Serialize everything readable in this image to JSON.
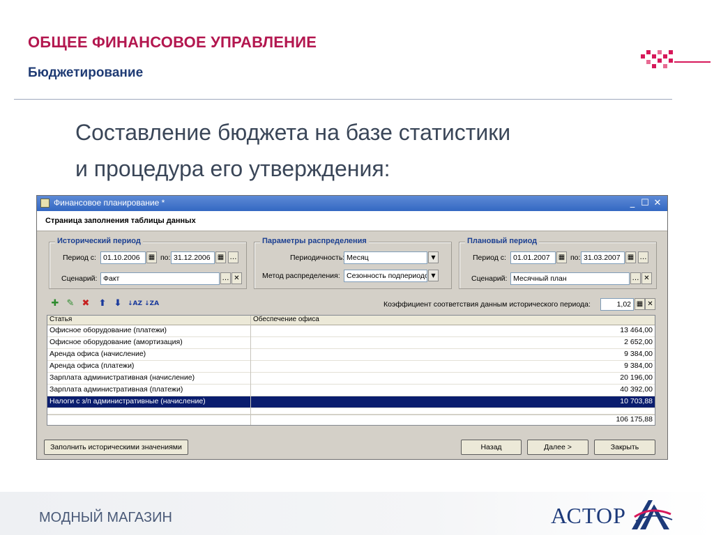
{
  "slide": {
    "title": "ОБЩЕЕ ФИНАНСОВОЕ УПРАВЛЕНИЕ",
    "subtitle": "Бюджетирование",
    "body_line1": "Составление бюджета на базе статистики",
    "body_line2": "и процедура его утверждения:"
  },
  "window": {
    "title": "Финансовое планирование *",
    "page_title": "Страница заполнения таблицы данных",
    "historical_period": {
      "legend": "Исторический период",
      "period_from_label": "Период с:",
      "period_from": "01.10.2006",
      "period_to_label": "по:",
      "period_to": "31.12.2006",
      "scenario_label": "Сценарий:",
      "scenario": "Факт"
    },
    "distribution": {
      "legend": "Параметры распределения",
      "periodicity_label": "Периодичность:",
      "periodicity": "Месяц",
      "method_label": "Метод распределения:",
      "method": "Сезонность подпериодов"
    },
    "planned_period": {
      "legend": "Плановый период",
      "period_from_label": "Период с:",
      "period_from": "01.01.2007",
      "period_to_label": "по:",
      "period_to": "31.03.2007",
      "scenario_label": "Сценарий:",
      "scenario": "Месячный план"
    },
    "coefficient_label": "Коэффициент соответствия данным исторического периода:",
    "coefficient_value": "1,02",
    "table": {
      "columns": [
        "Статья",
        "Обеспечение офиса"
      ],
      "rows": [
        {
          "article": "Офисное оборудование (платежи)",
          "value": "13 464,00"
        },
        {
          "article": "Офисное оборудование (амортизация)",
          "value": "2 652,00"
        },
        {
          "article": "Аренда офиса (начисление)",
          "value": "9 384,00"
        },
        {
          "article": "Аренда офиса (платежи)",
          "value": "9 384,00"
        },
        {
          "article": "Зарплата административная (начисление)",
          "value": "20 196,00"
        },
        {
          "article": "Зарплата административная (платежи)",
          "value": "40 392,00"
        },
        {
          "article": "Налоги с з/п административные (начисление)",
          "value": "10 703,88"
        }
      ],
      "total": "106 175,88"
    },
    "buttons": {
      "fill_history": "Заполнить историческими значениями",
      "back": "Назад",
      "next": "Далее >",
      "close": "Закрыть"
    }
  },
  "footer": {
    "text": "МОДНЫЙ МАГАЗИН",
    "brand": "АСТОР"
  },
  "colors": {
    "title_accent": "#b3174f",
    "subtitle": "#1f3b74",
    "selection": "#0a1d6e",
    "titlebar": "#3468c2"
  }
}
